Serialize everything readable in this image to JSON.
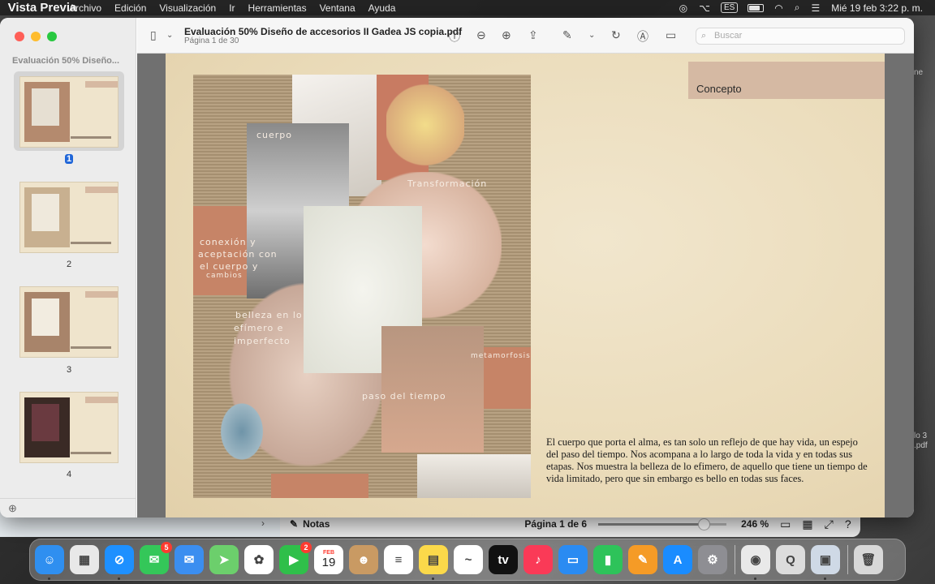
{
  "menubar": {
    "app_name": "Vista Previa",
    "items": [
      "Archivo",
      "Edición",
      "Visualización",
      "Ir",
      "Herramientas",
      "Ventana",
      "Ayuda"
    ],
    "input_source": "ES",
    "datetime": "Mié 19 feb  3:22 p. m."
  },
  "window": {
    "doc_title": "Evaluación 50% Diseño de accesorios II Gadea JS copia.pdf",
    "doc_subtitle": "Página 1 de 30",
    "search_placeholder": "Buscar"
  },
  "sidebar": {
    "title": "Evaluación 50% Diseño...",
    "pages": [
      "1",
      "2",
      "3",
      "4"
    ]
  },
  "page": {
    "concept_label": "Concepto",
    "body_text": "El cuerpo que porta el alma, es tan solo un reflejo de que hay vida, un espejo del paso del tiempo. Nos acompana a lo largo de toda la vida y en todas sus etapas. Nos muestra la belleza de lo efimero, de aquello que tiene un tiempo de vida limitado, pero que sin embargo es bello en todas sus faces.",
    "collage_labels": {
      "cuerpo": "cuerpo",
      "transformacion": "Transformación",
      "conexion": "conexión y",
      "aceptacion": "aceptación con",
      "el_cuerpo": "el cuerpo y",
      "cambios": "cambios",
      "belleza": "belleza en lo",
      "efimero": "efímero e",
      "imperfecto": "imperfecto",
      "metamorfosis": "metamorfosis",
      "paso": "paso del tiempo"
    }
  },
  "behind_window": {
    "notes_label": "Notas",
    "page_info": "Página 1 de 6",
    "zoom": "246 %",
    "zoom_slider_level": 0.82
  },
  "background_fragments": {
    "top": "ne",
    "file1": "lo 3",
    "file2": ".pdf"
  },
  "dock": {
    "apps": [
      {
        "name": "Finder",
        "color": "#2f8ff0",
        "glyph": "☺"
      },
      {
        "name": "Launchpad",
        "color": "#e8e8e8",
        "glyph": "▦"
      },
      {
        "name": "Safari",
        "color": "#1e90ff",
        "glyph": "⊘"
      },
      {
        "name": "Mensajes",
        "color": "#34c759",
        "glyph": "✉",
        "badge": "5"
      },
      {
        "name": "Mail",
        "color": "#3b8ef0",
        "glyph": "✉"
      },
      {
        "name": "Mapas",
        "color": "#6ccf6c",
        "glyph": "➤"
      },
      {
        "name": "Fotos",
        "color": "#ffffff",
        "glyph": "✿"
      },
      {
        "name": "FaceTime",
        "color": "#2fbf4a",
        "glyph": "▶",
        "badge": "2"
      },
      {
        "name": "Calendario",
        "color": "#ffffff",
        "glyph": "19",
        "sub": "FEB"
      },
      {
        "name": "Contactos",
        "color": "#c99a63",
        "glyph": "☻"
      },
      {
        "name": "Recordatorios",
        "color": "#ffffff",
        "glyph": "≡"
      },
      {
        "name": "Notas",
        "color": "#fbd94a",
        "glyph": "▤"
      },
      {
        "name": "Freeform",
        "color": "#ffffff",
        "glyph": "~"
      },
      {
        "name": "TV",
        "color": "#111111",
        "glyph": "tv"
      },
      {
        "name": "Música",
        "color": "#fa3a57",
        "glyph": "♪"
      },
      {
        "name": "Keynote",
        "color": "#2a8bf2",
        "glyph": "▭"
      },
      {
        "name": "Numbers",
        "color": "#2ec35a",
        "glyph": "▮"
      },
      {
        "name": "Pages",
        "color": "#f59b26",
        "glyph": "✎"
      },
      {
        "name": "App Store",
        "color": "#1a8cff",
        "glyph": "A"
      },
      {
        "name": "Configuración",
        "color": "#8e8e93",
        "glyph": "⚙"
      },
      {
        "name": "Chrome",
        "color": "#e9e9e9",
        "glyph": "◉"
      },
      {
        "name": "QuickTime",
        "color": "#dcdcdc",
        "glyph": "Q"
      },
      {
        "name": "Vista Previa",
        "color": "#cfd9e6",
        "glyph": "▣"
      },
      {
        "name": "Papelera",
        "color": "#d8d8d8",
        "glyph": "🗑"
      }
    ]
  }
}
